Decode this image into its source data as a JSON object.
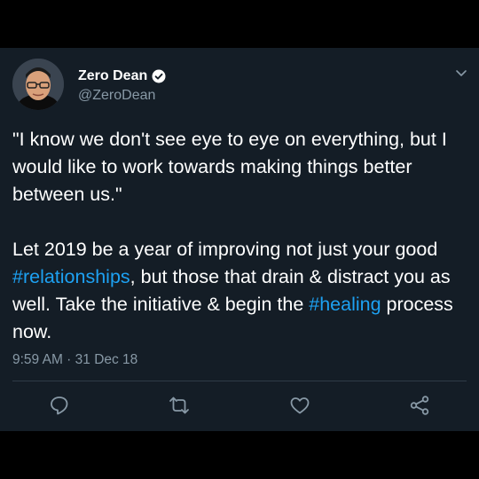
{
  "tweet": {
    "author_name": "Zero Dean",
    "author_handle": "@ZeroDean",
    "paragraphs": [
      [
        {
          "text": "\"I know we don't see eye to eye on everything, but I would like to work towards making things better between us.\""
        }
      ],
      [
        {
          "text": "Let 2019 be a year of improving not just your good "
        },
        {
          "text": "#relationships",
          "hashtag": true
        },
        {
          "text": ", but those that drain & distract you as well. Take the initiative & begin the "
        },
        {
          "text": "#healing",
          "hashtag": true
        },
        {
          "text": " process now."
        }
      ]
    ],
    "timestamp": "9:59 AM · 31 Dec 18",
    "verified": true
  },
  "actions": [
    {
      "name": "reply",
      "icon": "reply-icon"
    },
    {
      "name": "retweet",
      "icon": "retweet-icon"
    },
    {
      "name": "like",
      "icon": "heart-icon"
    },
    {
      "name": "share",
      "icon": "share-icon"
    }
  ],
  "colors": {
    "background": "#141d26",
    "letterbox": "#000000",
    "text_primary": "#ffffff",
    "text_secondary": "#8899a6",
    "link": "#1da1f2",
    "divider": "#2f3b47"
  }
}
